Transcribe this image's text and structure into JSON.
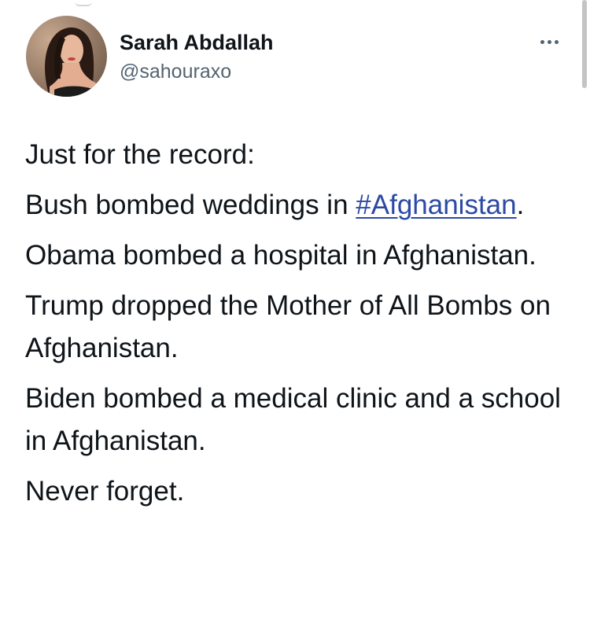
{
  "author": {
    "display_name": "Sarah Abdallah",
    "handle": "@sahouraxo",
    "avatar_icon": "profile-photo"
  },
  "menu": {
    "more_icon": "more-horizontal-icon"
  },
  "tweet": {
    "line1": "Just for the record:",
    "line2_text": "Bush bombed weddings in ",
    "line2_hashtag": "#Afghanistan",
    "line2_end": ".",
    "line3": "Obama bombed a hospital in Afghanistan.",
    "line4": "Trump dropped the Mother of All Bombs on Afghanistan.",
    "line5": "Biden bombed a medical clinic and a school in Afghanistan.",
    "line6": "Never forget."
  },
  "colors": {
    "text": "#0f1419",
    "secondary_text": "#536471",
    "hashtag": "#2c4aa5",
    "background": "#ffffff"
  }
}
